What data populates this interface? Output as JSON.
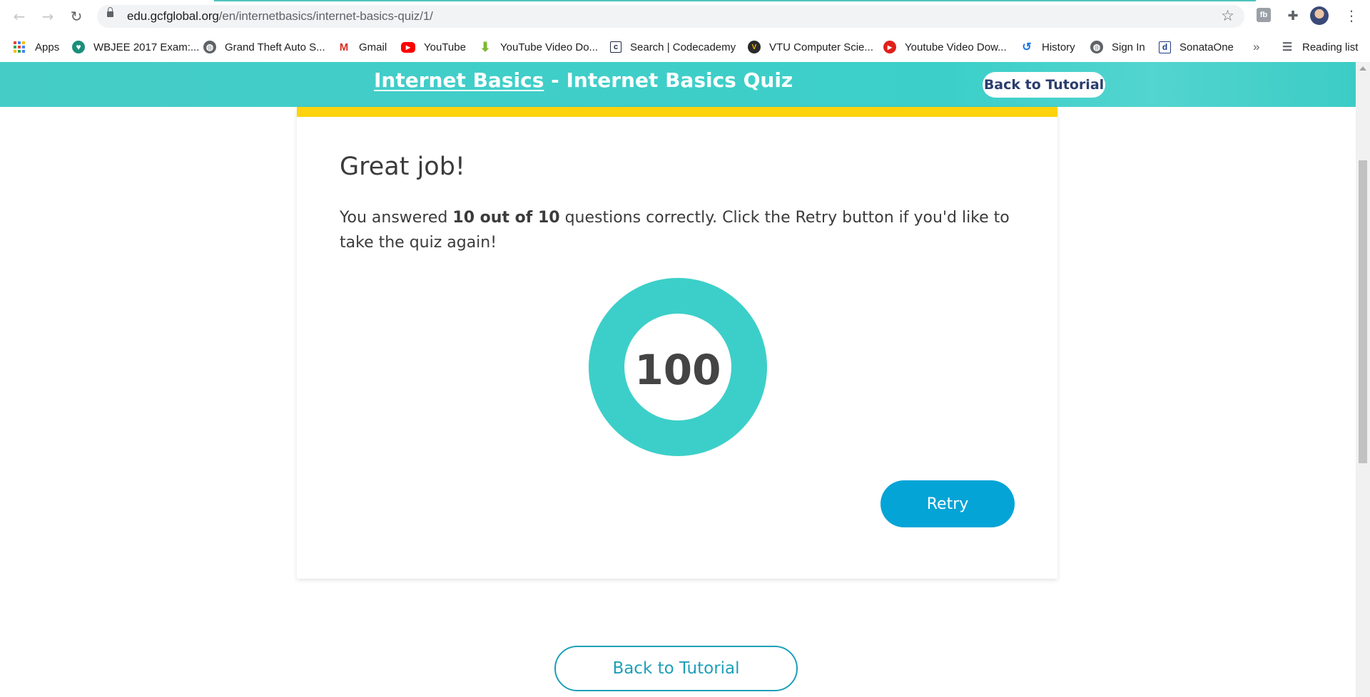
{
  "browser": {
    "url_host": "edu.gcfglobal.org",
    "url_path": "/en/internetbasics/internet-basics-quiz/1/",
    "extension_label": "fb",
    "more_label": "»",
    "reading_list_label": "Reading list",
    "bookmarks": [
      {
        "label": "Apps",
        "icon": "apps-grid-icon"
      },
      {
        "label": "WBJEE 2017 Exam:...",
        "icon": "wbjee-icon"
      },
      {
        "label": "Grand Theft Auto S...",
        "icon": "globe-icon"
      },
      {
        "label": "Gmail",
        "icon": "gmail-icon"
      },
      {
        "label": "YouTube",
        "icon": "youtube-icon"
      },
      {
        "label": "YouTube Video Do...",
        "icon": "download-icon"
      },
      {
        "label": "Search | Codecademy",
        "icon": "codecademy-icon"
      },
      {
        "label": "VTU Computer Scie...",
        "icon": "vtu-icon"
      },
      {
        "label": "Youtube Video Dow...",
        "icon": "youtube-dl-icon"
      },
      {
        "label": "History",
        "icon": "history-icon"
      },
      {
        "label": "Sign In",
        "icon": "globe-icon"
      },
      {
        "label": "SonataOne",
        "icon": "sonata-icon"
      }
    ]
  },
  "header": {
    "title_link": "Internet Basics",
    "title_separator": " - ",
    "title_rest": "Internet Basics Quiz",
    "back_button": "Back to Tutorial"
  },
  "result": {
    "heading": "Great job!",
    "text_before": "You answered ",
    "score_text": "10 out of 10",
    "text_after": " questions correctly. Click the Retry button if you'd like to take the quiz again!",
    "score": "100",
    "percent_correct": 100,
    "retry_button": "Retry"
  },
  "footer": {
    "back_button": "Back to Tutorial"
  },
  "colors": {
    "header_teal": "#3ccfc9",
    "accent_yellow": "#fdd30d",
    "retry_blue": "#05a4d6",
    "donut_teal": "#3ccfc9"
  }
}
